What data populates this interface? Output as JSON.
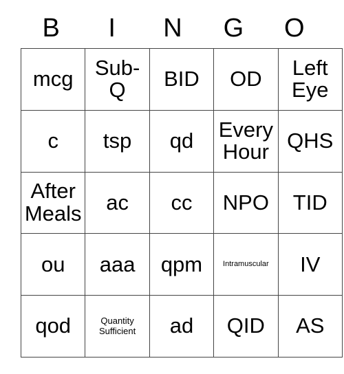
{
  "card": {
    "headers": [
      "B",
      "I",
      "N",
      "G",
      "O"
    ],
    "border_color": "#444444",
    "text_color": "#000000",
    "background_color": "#ffffff",
    "rows": [
      [
        {
          "text": "mcg",
          "size": "normal"
        },
        {
          "text": "Sub-Q",
          "size": "normal"
        },
        {
          "text": "BID",
          "size": "normal"
        },
        {
          "text": "OD",
          "size": "normal"
        },
        {
          "text": "Left Eye",
          "size": "normal"
        }
      ],
      [
        {
          "text": "c",
          "size": "normal"
        },
        {
          "text": "tsp",
          "size": "normal"
        },
        {
          "text": "qd",
          "size": "normal"
        },
        {
          "text": "Every Hour",
          "size": "normal"
        },
        {
          "text": "QHS",
          "size": "normal"
        }
      ],
      [
        {
          "text": "After Meals",
          "size": "normal"
        },
        {
          "text": "ac",
          "size": "normal"
        },
        {
          "text": "cc",
          "size": "normal"
        },
        {
          "text": "NPO",
          "size": "normal"
        },
        {
          "text": "TID",
          "size": "normal"
        }
      ],
      [
        {
          "text": "ou",
          "size": "normal"
        },
        {
          "text": "aaa",
          "size": "normal"
        },
        {
          "text": "qpm",
          "size": "normal"
        },
        {
          "text": "Intramuscular",
          "size": "xsmall"
        },
        {
          "text": "IV",
          "size": "normal"
        }
      ],
      [
        {
          "text": "qod",
          "size": "normal"
        },
        {
          "text": "Quantity Sufficient",
          "size": "small"
        },
        {
          "text": "ad",
          "size": "normal"
        },
        {
          "text": "QID",
          "size": "normal"
        },
        {
          "text": "AS",
          "size": "normal"
        }
      ]
    ]
  }
}
